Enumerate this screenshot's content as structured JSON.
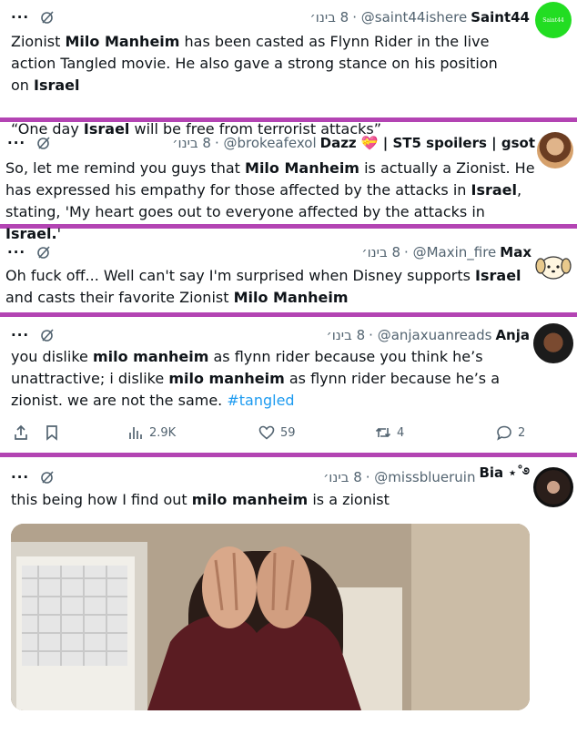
{
  "colors": {
    "separator": "#b344b3",
    "hashtag": "#1d9bf0",
    "secondary_text": "#536471"
  },
  "tweets": [
    {
      "more": "···",
      "date": "8 בינו׳",
      "handle": "@saint44ishere",
      "name": "Saint44",
      "avatar_text": "Saint44",
      "segments": [
        {
          "t": "Zionist "
        },
        {
          "b": "Milo Manheim"
        },
        {
          "t": " has been casted as Flynn Rider in the live action Tangled movie. He also gave a strong stance on his position on "
        },
        {
          "b": "Israel"
        },
        {
          "br": true
        },
        {
          "br": true
        },
        {
          "t": "“One day "
        },
        {
          "b": "Israel"
        },
        {
          "t": " will be free from terrorist attacks”"
        }
      ]
    },
    {
      "more": "···",
      "date": "8 בינו׳",
      "handle": "@brokeafexol",
      "name": "Dazz 💝 | ST5 spoilers | gsot",
      "segments": [
        {
          "t": "So, let me remind you guys that "
        },
        {
          "b": "Milo Manheim"
        },
        {
          "t": " is actually a Zionist. He has expressed his empathy for those affected by the attacks in "
        },
        {
          "b": "Israel"
        },
        {
          "t": ", stating, 'My heart goes out to everyone affected by the attacks in "
        },
        {
          "b": "Israel."
        },
        {
          "t": "'"
        }
      ]
    },
    {
      "more": "···",
      "date": "8 בינו׳",
      "handle": "@Maxin_fire",
      "name": "Max",
      "segments": [
        {
          "t": "Oh fuck off... Well can't say I'm surprised when Disney supports "
        },
        {
          "b": "Israel"
        },
        {
          "t": " and casts their favorite Zionist "
        },
        {
          "b": "Milo Manheim"
        }
      ]
    },
    {
      "more": "···",
      "date": "8 בינו׳",
      "handle": "@anjaxuanreads",
      "name": "Anja",
      "segments": [
        {
          "t": "you dislike "
        },
        {
          "b": "milo manheim"
        },
        {
          "t": " as flynn rider because you think he’s unattractive; i dislike "
        },
        {
          "b": "milo manheim"
        },
        {
          "t": " as flynn rider because he’s a zionist. we are not the same. "
        },
        {
          "h": "#tangled"
        }
      ],
      "actions": {
        "views": "2.9K",
        "likes": "59",
        "retweets": "4",
        "replies": "2"
      }
    },
    {
      "more": "···",
      "date": "8 בינו׳",
      "handle": "@missblueruin",
      "name": "Bia ⋆˚࿔",
      "segments": [
        {
          "t": "this being how I find out "
        },
        {
          "b": "milo manheim"
        },
        {
          "t": " is a zionist"
        }
      ]
    }
  ]
}
